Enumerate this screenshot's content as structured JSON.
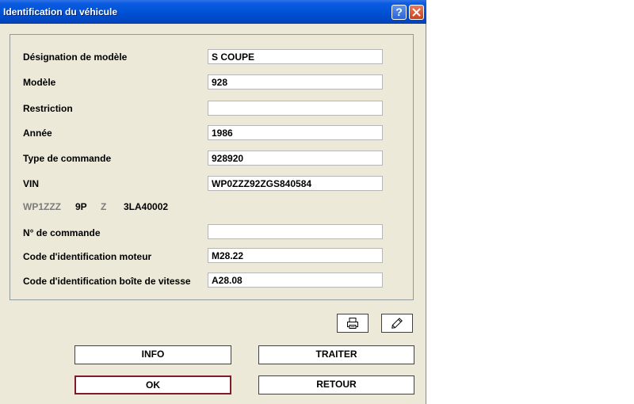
{
  "window": {
    "title": "Identification du véhicule",
    "help_label": "?",
    "close_label": "✕"
  },
  "fields": [
    {
      "label": "Désignation de modèle",
      "value": "S COUPE"
    },
    {
      "label": "Modèle",
      "value": "928"
    },
    {
      "label": "Restriction",
      "value": ""
    },
    {
      "label": "Année",
      "value": "1986"
    },
    {
      "label": "Type de commande",
      "value": "928920"
    },
    {
      "label": "VIN",
      "value": "WP0ZZZ92ZGS840584"
    },
    {
      "label": "N° de commande",
      "value": ""
    },
    {
      "label": "Code d'identification moteur",
      "value": "M28.22"
    },
    {
      "label": "Code d'identification boîte de vitesse",
      "value": "A28.08"
    }
  ],
  "vin_breakdown": {
    "wmi": "WP1ZZZ",
    "model": "9P",
    "filler": "Z",
    "serial": "3LA40002"
  },
  "buttons": {
    "info": "INFO",
    "traiter": "TRAITER",
    "ok": "OK",
    "retour": "RETOUR"
  },
  "icons": {
    "print": "printer-icon",
    "edit": "pencil-icon"
  },
  "colors": {
    "titlebar": "#0052d6",
    "dialog_bg": "#ece9d8",
    "default_button_border": "#7f1c2c"
  }
}
